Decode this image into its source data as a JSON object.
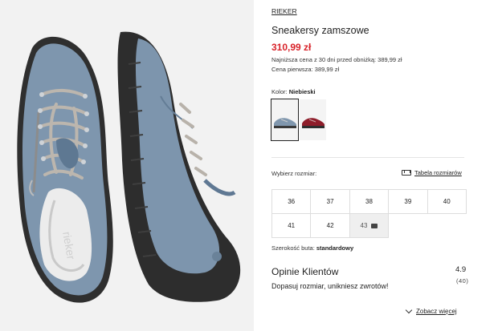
{
  "product": {
    "brand": "RIEKER",
    "title": "Sneakersy zamszowe",
    "price": "310,99 zł",
    "lowest_price_note": "Najniższa cena z 30 dni przed obniżką: 389,99 zł",
    "first_price_note": "Cena pierwsza: 389,99 zł"
  },
  "color": {
    "label": "Kolor:",
    "value": "Niebieski",
    "swatches": [
      "blue-grey",
      "red"
    ]
  },
  "size": {
    "label": "Wybierz rozmiar:",
    "table_link": "Tabela rozmiarów",
    "options": [
      "36",
      "37",
      "38",
      "39",
      "40",
      "41",
      "42",
      "43"
    ],
    "unavailable": [
      "43"
    ]
  },
  "width": {
    "label": "Szerokość buta:",
    "value": "standardowy"
  },
  "reviews": {
    "heading": "Opinie Klientów",
    "rating": "4.9",
    "count": "(40)",
    "promo": "Dopasuj rozmiar, unikniesz zwrotów!",
    "more_link": "Zobacz więcej"
  },
  "colors": {
    "price": "#d8232a",
    "suede": "#7d95ad",
    "sole": "#2b2b2b"
  }
}
